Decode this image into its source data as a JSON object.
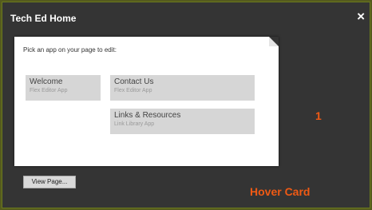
{
  "window": {
    "title": "Tech Ed Home",
    "close_icon": "×"
  },
  "card": {
    "prompt": "Pick an app on your page to edit:",
    "apps": [
      {
        "name": "Welcome",
        "type": "Flex Editor App"
      },
      {
        "name": "Contact Us",
        "type": "Flex Editor App"
      },
      {
        "name": "Links & Resources",
        "type": "Link Library App"
      }
    ]
  },
  "footer": {
    "view_button": "View Page..."
  },
  "annotations": {
    "number": "1",
    "label": "Hover Card",
    "color": "#f05a14"
  }
}
